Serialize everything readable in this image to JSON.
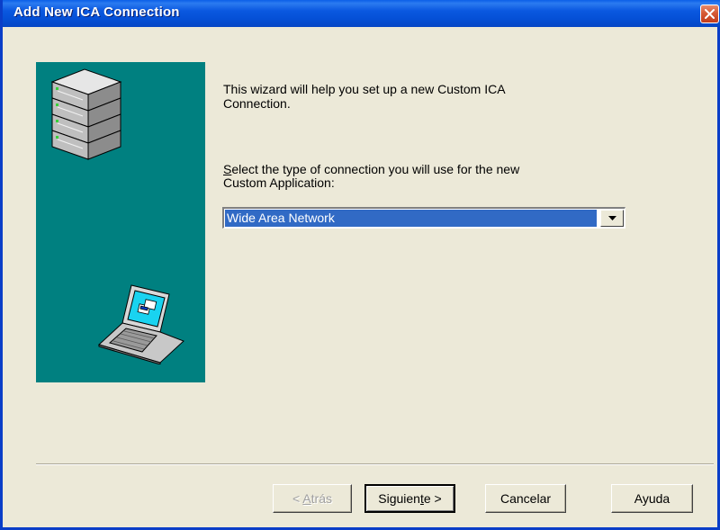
{
  "window": {
    "title": "Add New ICA Connection",
    "close_icon": "close-icon"
  },
  "wizard": {
    "intro_line1": "This wizard will help you set up a new Custom ICA",
    "intro_line2": "Connection.",
    "select_label_first_letter": "S",
    "select_label_line1_rest": "elect the type of connection you will use for the new",
    "select_label_line2": "Custom Application:",
    "connection_type": {
      "selected": "Wide Area Network"
    }
  },
  "buttons": {
    "back_prefix": "< ",
    "back_hotkey": "A",
    "back_rest": "trás",
    "next_pre": "Siguien",
    "next_hotkey": "t",
    "next_post": "e >",
    "cancel": "Cancelar",
    "help": "Ayuda"
  },
  "colors": {
    "panel": "#008080",
    "title_bar": "#0a58e0",
    "selection": "#316ac5"
  },
  "icons": [
    "server-stack-icon",
    "laptop-icon",
    "close-icon",
    "dropdown-arrow-icon"
  ]
}
